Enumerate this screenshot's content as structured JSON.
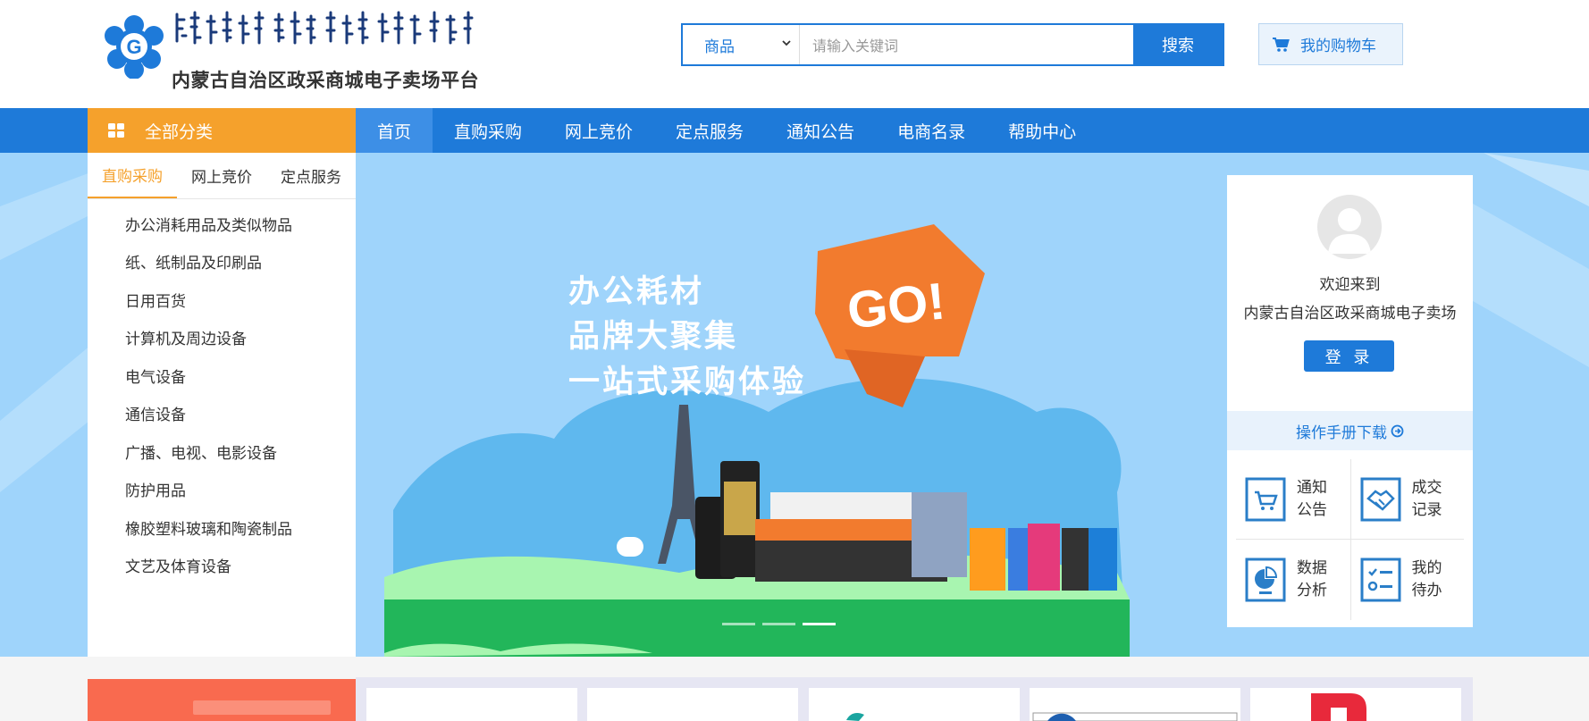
{
  "header": {
    "logo_text": "内蒙古自治区政采商城电子卖场平台",
    "logo_mongolian": "ᠥᠪᠦᠷ ᠮᠣᠩᠭᠣᠯ ᠤᠨ ᠥᠪᠡᠷᠲᠡᠭᠡᠨ ᠵᠠᠰᠠᠬᠤ ᠣᠷᠣᠨ"
  },
  "search": {
    "category": "商品",
    "placeholder": "请输入关键词",
    "button": "搜索"
  },
  "cart": {
    "label": "我的购物车"
  },
  "nav": {
    "all_categories": "全部分类",
    "items": [
      {
        "label": "首页"
      },
      {
        "label": "直购采购"
      },
      {
        "label": "网上竞价"
      },
      {
        "label": "定点服务"
      },
      {
        "label": "通知公告"
      },
      {
        "label": "电商名录"
      },
      {
        "label": "帮助中心"
      }
    ]
  },
  "sidebar": {
    "tabs": [
      {
        "label": "直购采购"
      },
      {
        "label": "网上竞价"
      },
      {
        "label": "定点服务"
      }
    ],
    "items": [
      {
        "label": "办公消耗用品及类似物品"
      },
      {
        "label": "纸、纸制品及印刷品"
      },
      {
        "label": "日用百货"
      },
      {
        "label": "计算机及周边设备"
      },
      {
        "label": "电气设备"
      },
      {
        "label": "通信设备"
      },
      {
        "label": "广播、电视、电影设备"
      },
      {
        "label": "防护用品"
      },
      {
        "label": "橡胶塑料玻璃和陶瓷制品"
      },
      {
        "label": "文艺及体育设备"
      }
    ]
  },
  "banner": {
    "lines": [
      "办公耗材",
      "品牌大聚集",
      "一站式采购体验"
    ],
    "badge": "GO!",
    "active_slide": 3,
    "slides": 3
  },
  "user": {
    "welcome": "欢迎来到",
    "site": "内蒙古自治区政采商城电子卖场",
    "login": "登 录",
    "manual": "操作手册下载",
    "quick": [
      {
        "label": "通知公告",
        "icon": "cart-notice-icon"
      },
      {
        "label": "成交记录",
        "icon": "handshake-icon"
      },
      {
        "label": "数据分析",
        "icon": "data-analysis-icon"
      },
      {
        "label": "我的待办",
        "icon": "todo-list-icon"
      }
    ]
  },
  "colors": {
    "primary": "#1e7ad9",
    "accent": "#f5a12c",
    "banner_bg": "#9fd4fb"
  }
}
